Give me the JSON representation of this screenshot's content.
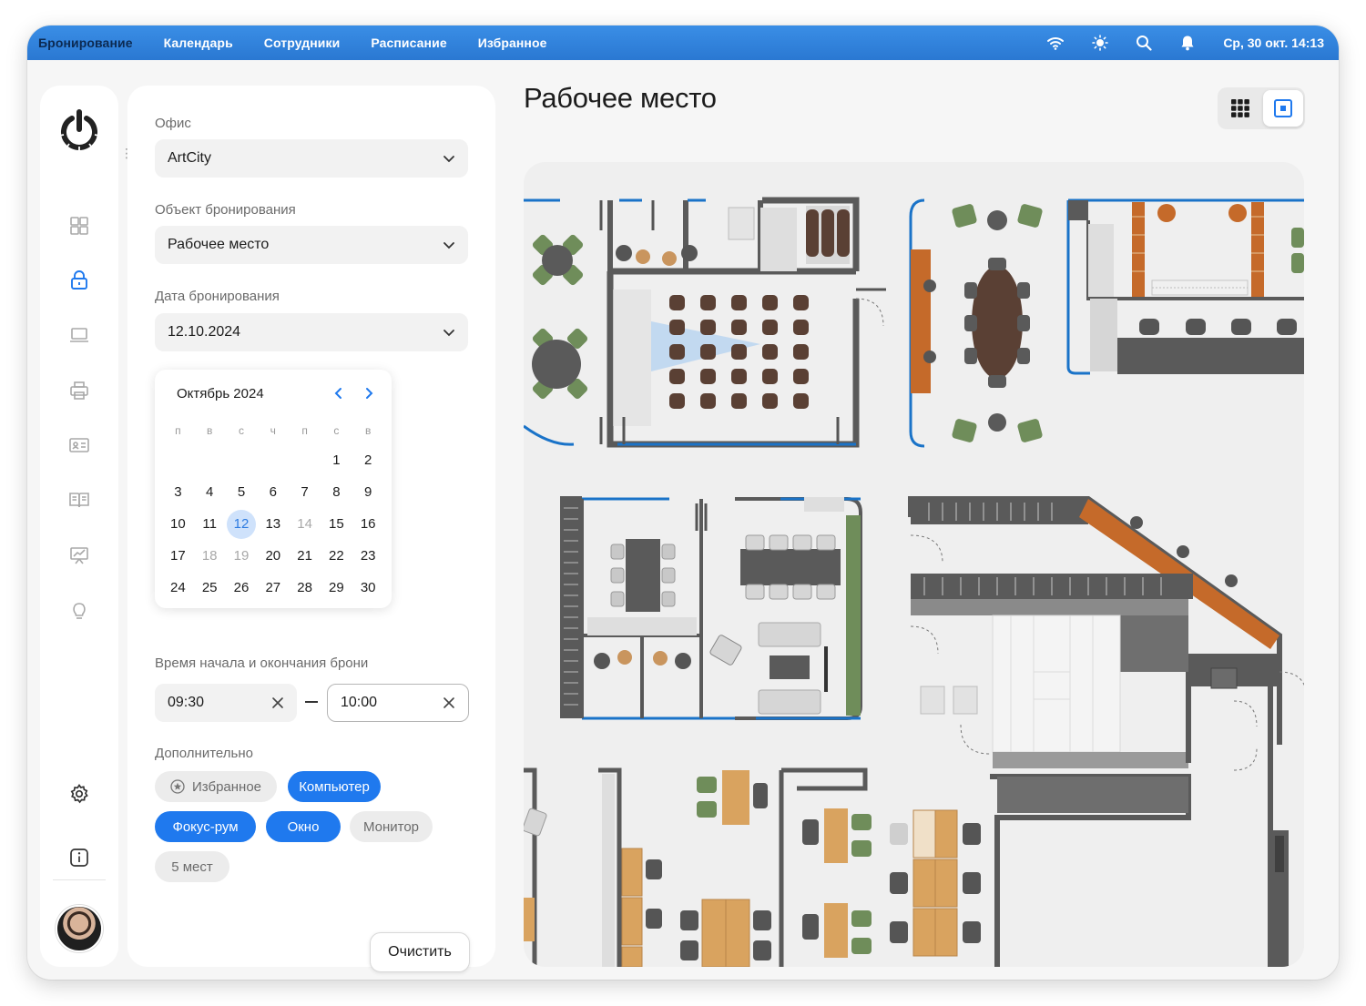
{
  "topbar": {
    "menu": [
      "Бронирование",
      "Календарь",
      "Сотрудники",
      "Расписание",
      "Избранное"
    ],
    "datetime": "Ср, 30 окт. 14:13"
  },
  "sidebar": {
    "icons": [
      "dashboard-icon",
      "lock-icon",
      "laptop-icon",
      "printer-icon",
      "id-card-icon",
      "book-icon",
      "presentation-icon",
      "lightbulb-icon"
    ],
    "active": "lock-icon"
  },
  "filters": {
    "office": {
      "label": "Офис",
      "value": "ArtCity"
    },
    "object": {
      "label": "Объект бронирования",
      "value": "Рабочее место"
    },
    "date": {
      "label": "Дата бронирования",
      "value": "12.10.2024"
    },
    "calendar": {
      "month": "Октябрь 2024",
      "weekdays": [
        "п",
        "в",
        "с",
        "ч",
        "п",
        "с",
        "в"
      ],
      "weeks": [
        [
          "",
          "",
          "",
          "",
          "",
          "1",
          "2"
        ],
        [
          "3",
          "4",
          "5",
          "6",
          "7",
          "8",
          "9"
        ],
        [
          "10",
          "11",
          "12",
          "13",
          "14",
          "15",
          "16"
        ],
        [
          "17",
          "18",
          "19",
          "20",
          "21",
          "22",
          "23"
        ],
        [
          "24",
          "25",
          "26",
          "27",
          "28",
          "29",
          "30"
        ]
      ],
      "selected": "12",
      "disabled": [
        "14",
        "18",
        "19"
      ]
    },
    "time": {
      "label": "Время начала и окончания брони",
      "start": "09:30",
      "end": "10:00"
    },
    "extras": {
      "label": "Дополнительно",
      "chips": [
        {
          "label": "Избранное",
          "active": false
        },
        {
          "label": "Компьютер",
          "active": true
        },
        {
          "label": "Фокус-рум",
          "active": true
        },
        {
          "label": "Окно",
          "active": true
        },
        {
          "label": "Монитор",
          "active": false
        },
        {
          "label": "5 мест",
          "active": false
        }
      ]
    },
    "clear_label": "Очистить"
  },
  "main": {
    "title": "Рабочее место"
  },
  "colors": {
    "accent": "#1f79ee",
    "topbar": "#2a78d2",
    "wall": "#5a5a5a",
    "window": "#1a73c8",
    "wood": "#c56a2a",
    "chair_green": "#6f8d5a",
    "chair_brown": "#5a4034"
  }
}
